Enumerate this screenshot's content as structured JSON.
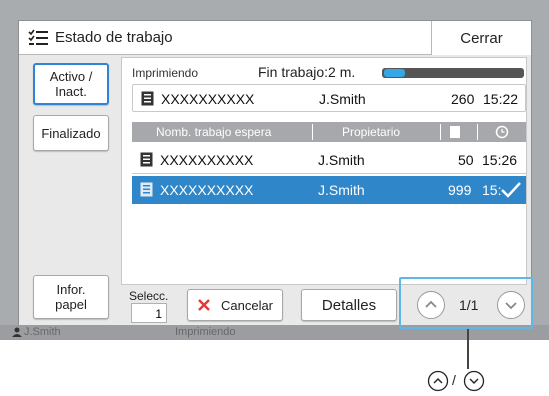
{
  "title_bar": {
    "title": "Estado de trabajo",
    "close_label": "Cerrar"
  },
  "sidebar": {
    "tabs": [
      {
        "label": "Activo / Inact."
      },
      {
        "label": "Finalizado"
      }
    ],
    "paper_info_label": "Infor. papel"
  },
  "printing": {
    "label": "Imprimiendo",
    "finish_label": "Fin trabajo:2 m.",
    "progress": 0.15,
    "job": {
      "name": "XXXXXXXXXX",
      "owner": "J.Smith",
      "pages": "260",
      "time": "15:22"
    }
  },
  "queue": {
    "headers": {
      "name": "Nomb. trabajo espera",
      "owner": "Propietario"
    },
    "rows": [
      {
        "name": "XXXXXXXXXX",
        "owner": "J.Smith",
        "pages": "50",
        "time": "15:26"
      },
      {
        "name": "XXXXXXXXXX",
        "owner": "J.Smith",
        "pages": "999",
        "time": "15:"
      }
    ]
  },
  "bottom": {
    "selec_label": "Selecc.",
    "selec_value": "1",
    "cancel_label": "Cancelar",
    "details_label": "Detalles",
    "page_indicator": "1/1"
  },
  "status_strip": {
    "user": "J.Smith",
    "state": "Imprimiendo"
  },
  "legend": {
    "separator": "/"
  },
  "colors": {
    "accent": "#2f86c8",
    "highlight": "#5fb7e8",
    "progress": "#35a7e4",
    "cancel": "#e53935"
  }
}
